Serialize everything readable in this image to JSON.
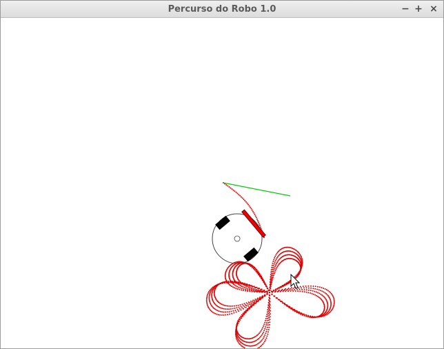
{
  "window": {
    "title": "Percurso do Robo 1.0",
    "controls": {
      "minimize_glyph": "−",
      "maximize_glyph": "+",
      "close_glyph": "×"
    }
  },
  "colors": {
    "trail": "#dd0000",
    "heading_line": "#00cc00",
    "robot_body_outline": "#444444",
    "wheels": "#000000",
    "bumper": "#ee0000"
  },
  "icons": {
    "cursor": "arrow-cursor-icon"
  }
}
